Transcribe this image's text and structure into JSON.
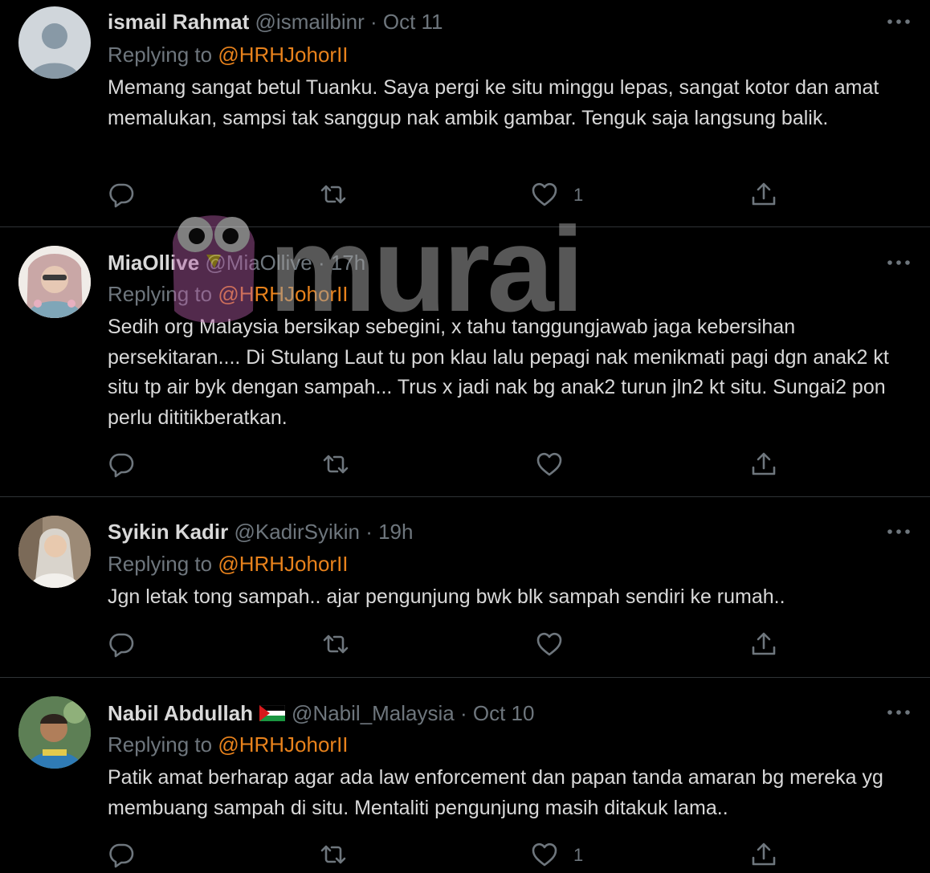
{
  "tweets": [
    {
      "name": "ismail Rahmat",
      "handle": "@ismailbinr",
      "time": "· Oct 11",
      "replying_prefix": "Replying to",
      "replying_to": "@HRHJohorII",
      "text": "Memang sangat betul Tuanku. Saya pergi ke situ minggu lepas, sangat kotor dan amat memalukan, sampsi tak sanggup nak ambik gambar. Tenguk saja langsung balik.",
      "likes": "1"
    },
    {
      "name": "MiaOllive",
      "handle": "@MiaOllive",
      "time": "· 17h",
      "replying_prefix": "Replying to",
      "replying_to": "@HRHJohorII",
      "text": "Sedih org Malaysia bersikap sebegini, x tahu tanggungjawab jaga kebersihan persekitaran....  Di Stulang Laut tu pon klau lalu pepagi nak menikmati pagi dgn anak2 kt situ tp air byk dengan sampah...  Trus x jadi nak bg anak2 turun jln2 kt situ. Sungai2 pon perlu dititikberatkan.",
      "likes": ""
    },
    {
      "name": "Syikin Kadir",
      "handle": "@KadirSyikin",
      "time": "· 19h",
      "replying_prefix": "Replying to",
      "replying_to": "@HRHJohorII",
      "text": "Jgn letak tong sampah.. ajar pengunjung bwk blk sampah sendiri ke rumah..",
      "likes": ""
    },
    {
      "name": "Nabil Abdullah",
      "handle": "@Nabil_Malaysia",
      "time": "· Oct 10",
      "replying_prefix": "Replying to",
      "replying_to": "@HRHJohorII",
      "text": "Patik amat berharap agar ada law enforcement dan papan tanda amaran bg mereka yg membuang sampah di situ. Mentaliti pengunjung masih ditakuk lama..",
      "likes": "1"
    }
  ],
  "watermark": {
    "text": "murai"
  },
  "colors": {
    "background": "#000000",
    "mention": "#e8821c",
    "muted": "#6e767d",
    "text": "#d9d9d9",
    "divider": "#2f3336"
  }
}
